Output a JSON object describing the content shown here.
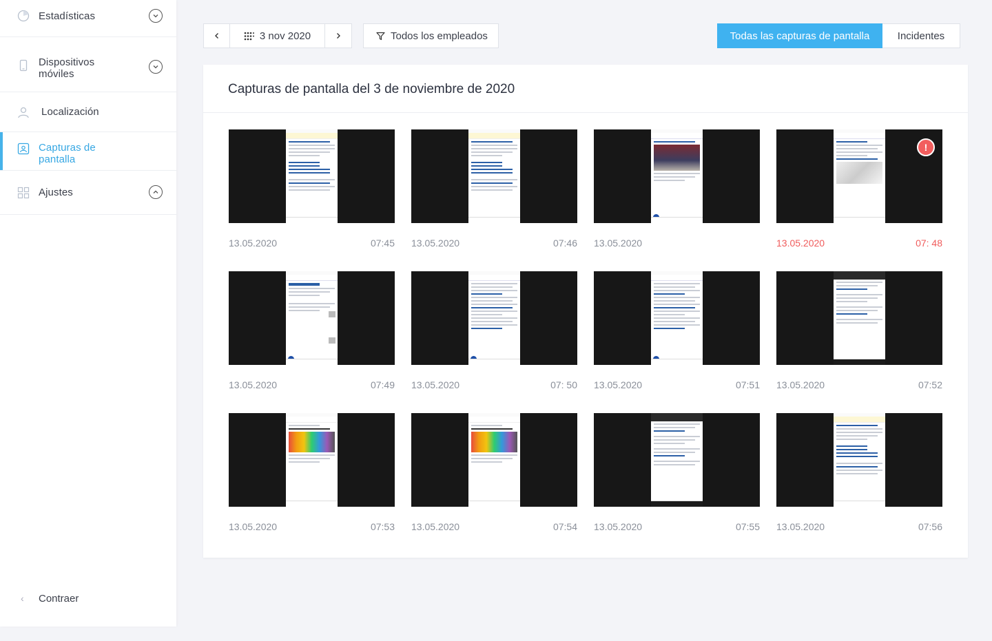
{
  "sidebar": {
    "items": [
      {
        "label": "Estadísticas",
        "icon": "chart-pie-icon",
        "chevron": "down",
        "active": false
      },
      {
        "label_line1": "Dispositivos",
        "label_line2": "móviles",
        "icon": "mobile-icon",
        "chevron": "down",
        "active": false
      },
      {
        "label": "Localización",
        "icon": "user-location-icon",
        "active": false
      },
      {
        "label_line1": "Capturas de",
        "label_line2": "pantalla",
        "icon": "screenshot-icon",
        "active": true
      },
      {
        "label": "Ajustes",
        "icon": "grid-settings-icon",
        "chevron": "up",
        "active": false
      }
    ],
    "collapse_label": "Contraer"
  },
  "toolbar": {
    "date": "3 nov 2020",
    "employees_filter": "Todos los empleados",
    "tabs": [
      {
        "label": "Todas las capturas de pantalla",
        "active": true
      },
      {
        "label": "Incidentes",
        "active": false
      }
    ]
  },
  "card": {
    "title": "Capturas de pantalla del 3 de noviembre de 2020"
  },
  "screenshots": [
    {
      "date": "13.05.2020",
      "time": "07:45",
      "incident": false,
      "kind": "vk"
    },
    {
      "date": "13.05.2020",
      "time": "07:46",
      "incident": false,
      "kind": "vk"
    },
    {
      "date": "13.05.2020",
      "time": "",
      "incident": false,
      "kind": "news-img"
    },
    {
      "date": "13.05.2020",
      "time": "07: 48",
      "incident": true,
      "kind": "room"
    },
    {
      "date": "13.05.2020",
      "time": "07:49",
      "incident": false,
      "kind": "news-list"
    },
    {
      "date": "13.05.2020",
      "time": "07: 50",
      "incident": false,
      "kind": "article"
    },
    {
      "date": "13.05.2020",
      "time": "07:51",
      "incident": false,
      "kind": "article"
    },
    {
      "date": "13.05.2020",
      "time": "07:52",
      "incident": false,
      "kind": "dark-list"
    },
    {
      "date": "13.05.2020",
      "time": "07:53",
      "incident": false,
      "kind": "palette"
    },
    {
      "date": "13.05.2020",
      "time": "07:54",
      "incident": false,
      "kind": "palette"
    },
    {
      "date": "13.05.2020",
      "time": "07:55",
      "incident": false,
      "kind": "dark-list"
    },
    {
      "date": "13.05.2020",
      "time": "07:56",
      "incident": false,
      "kind": "vk"
    }
  ],
  "incident_badge": "!",
  "colors": {
    "accent": "#3fb2f0",
    "incident": "#f05c5c",
    "active_border": "#46b3ea"
  }
}
